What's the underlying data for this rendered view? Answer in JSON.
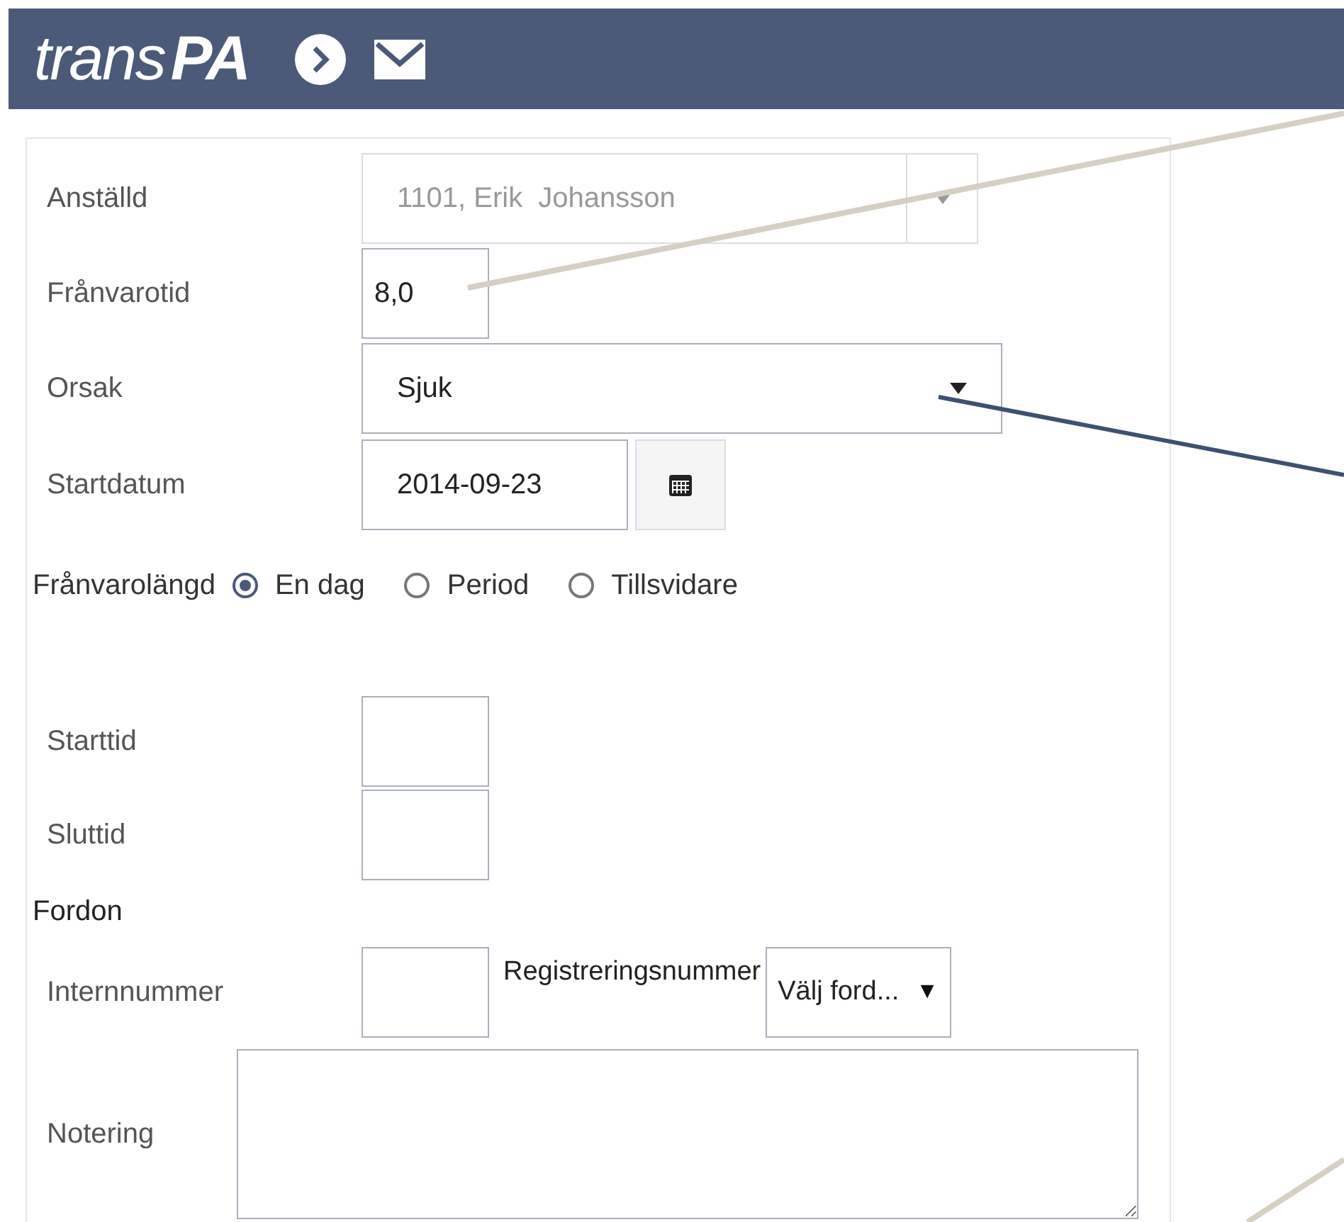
{
  "header": {
    "logo": {
      "part_1": "trans",
      "part_2": "PA"
    }
  },
  "fields": [
    {
      "kind": "select",
      "label": "Anställd",
      "value": "1101, Erik  Johansson",
      "disabled": true
    },
    {
      "kind": "text",
      "label": "Frånvarotid",
      "value": "8,0"
    },
    {
      "kind": "select",
      "label": "Orsak",
      "value": "Sjuk",
      "disabled": false
    },
    {
      "kind": "date",
      "label": "Startdatum",
      "value": "2014-09-23"
    },
    {
      "kind": "radio",
      "label": "Frånvarolängd",
      "options": [
        {
          "label": "En dag",
          "selected": true
        },
        {
          "label": "Period",
          "selected": false
        },
        {
          "label": "Tillsvidare",
          "selected": false
        }
      ]
    },
    {
      "kind": "spacer"
    },
    {
      "kind": "text",
      "label": "Starttid"
    },
    {
      "kind": "text",
      "label": "Sluttid"
    },
    {
      "kind": "heading",
      "label": "Fordon"
    },
    {
      "kind": "vehicle",
      "label": "Internnummer",
      "select_label": "Registreringsnummer",
      "select_value": "Välj ford...",
      "arrow": "▼"
    },
    {
      "kind": "textarea",
      "label": "Notering"
    }
  ]
}
